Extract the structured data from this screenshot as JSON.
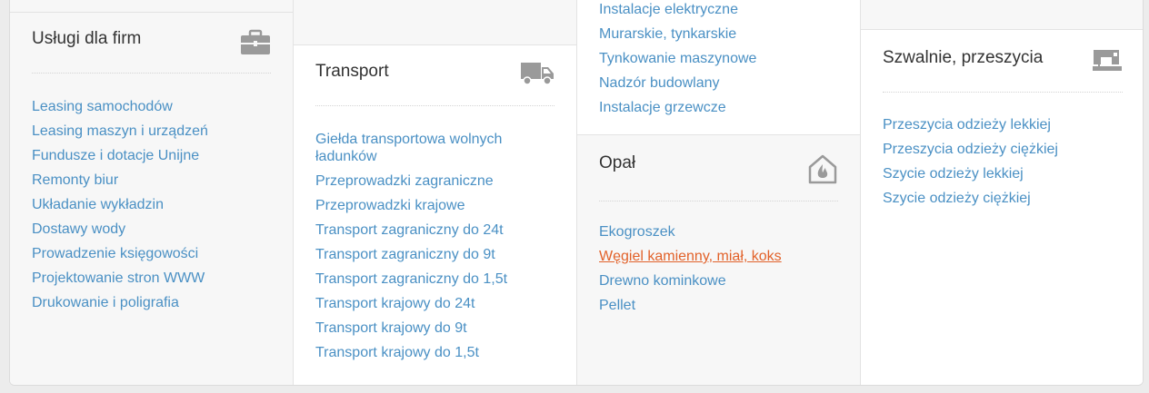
{
  "col1": {
    "title": "Usługi dla firm",
    "icon": "briefcase-icon",
    "links": [
      "Leasing samochodów",
      "Leasing maszyn i urządzeń",
      "Fundusze i dotacje Unijne",
      "Remonty biur",
      "Układanie wykładzin",
      "Dostawy wody",
      "Prowadzenie księgowości",
      "Projektowanie stron WWW",
      "Drukowanie i poligrafia"
    ]
  },
  "col2": {
    "title": "Transport",
    "icon": "truck-icon",
    "links": [
      "Giełda transportowa wolnych ładunków",
      "Przeprowadzki zagraniczne",
      "Przeprowadzki krajowe",
      "Transport zagraniczny do 24t",
      "Transport zagraniczny do 9t",
      "Transport zagraniczny do 1,5t",
      "Transport krajowy do 24t",
      "Transport krajowy do 9t",
      "Transport krajowy do 1,5t"
    ]
  },
  "col3": {
    "top_links": [
      "Instalacje elektryczne",
      "Murarskie, tynkarskie",
      "Tynkowanie maszynowe",
      "Nadzór budowlany",
      "Instalacje grzewcze"
    ],
    "title": "Opał",
    "icon": "house-fire-icon",
    "links": [
      "Ekogroszek",
      "Węgiel kamienny, miał, koks",
      "Drewno kominkowe",
      "Pellet"
    ],
    "active_link": "Węgiel kamienny, miał, koks"
  },
  "col4": {
    "title": "Szwalnie, przeszycia",
    "icon": "sewing-machine-icon",
    "links": [
      "Przeszycia odzieży lekkiej",
      "Przeszycia odzieży ciężkiej",
      "Szycie odzieży lekkiej",
      "Szycie odzieży ciężkiej"
    ]
  },
  "colors": {
    "link": "#4a90c4",
    "active": "#e2622a",
    "title": "#333333",
    "icon": "#9a9a9a"
  }
}
